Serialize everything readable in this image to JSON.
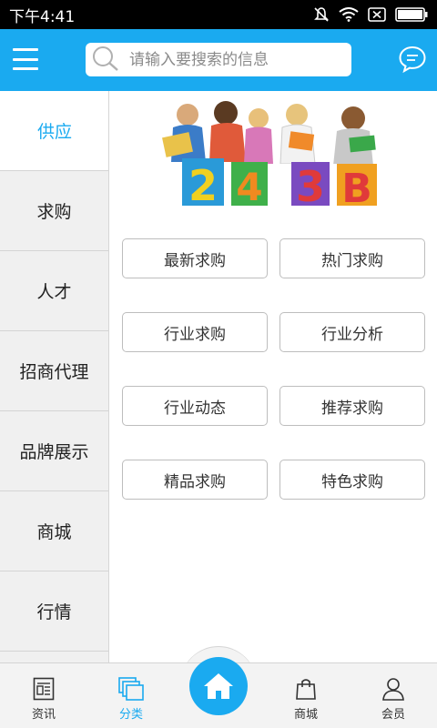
{
  "status_bar": {
    "time": "下午4:41"
  },
  "header": {
    "menu_icon": "hamburger-menu-icon",
    "search_placeholder": "请输入要搜索的信息",
    "chat_icon": "chat-bubble-icon",
    "accent_color": "#1aaaf0"
  },
  "sidebar": {
    "items": [
      {
        "label": "供应",
        "active": true
      },
      {
        "label": "求购",
        "active": false
      },
      {
        "label": "人才",
        "active": false
      },
      {
        "label": "招商代理",
        "active": false
      },
      {
        "label": "品牌展示",
        "active": false
      },
      {
        "label": "商城",
        "active": false
      },
      {
        "label": "行情",
        "active": false
      }
    ]
  },
  "banner": {
    "image": "children-with-books-and-letters-banner"
  },
  "grid": {
    "buttons": [
      "最新求购",
      "热门求购",
      "行业求购",
      "行业分析",
      "行业动态",
      "推荐求购",
      "精品求购",
      "特色求购"
    ]
  },
  "bottom_nav": {
    "items": [
      {
        "label": "资讯",
        "icon": "news-icon",
        "active": false
      },
      {
        "label": "分类",
        "icon": "category-icon",
        "active": true
      },
      {
        "label": "",
        "icon": "home-icon",
        "active": false
      },
      {
        "label": "商城",
        "icon": "shopping-bag-icon",
        "active": false
      },
      {
        "label": "会员",
        "icon": "user-icon",
        "active": false
      }
    ]
  }
}
